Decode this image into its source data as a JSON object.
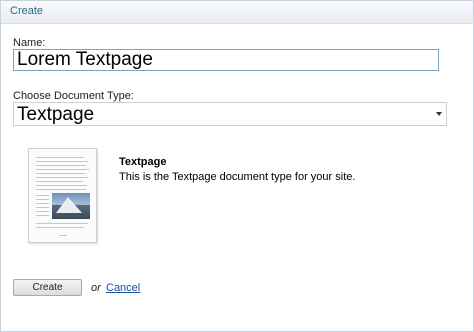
{
  "dialog": {
    "title": "Create"
  },
  "form": {
    "name_label": "Name:",
    "name_value": "Lorem Textpage",
    "type_label": "Choose Document Type:",
    "type_selected": "Textpage"
  },
  "doctype": {
    "name": "Textpage",
    "description": "This is the Textpage document type for your site.",
    "preview_icon": "document-thumbnail-icon"
  },
  "actions": {
    "create_label": "Create",
    "or_text": "or",
    "cancel_label": "Cancel"
  },
  "colors": {
    "title": "#2b6a8e",
    "link": "#1a4ea3",
    "input_border": "#7aa3c7"
  }
}
